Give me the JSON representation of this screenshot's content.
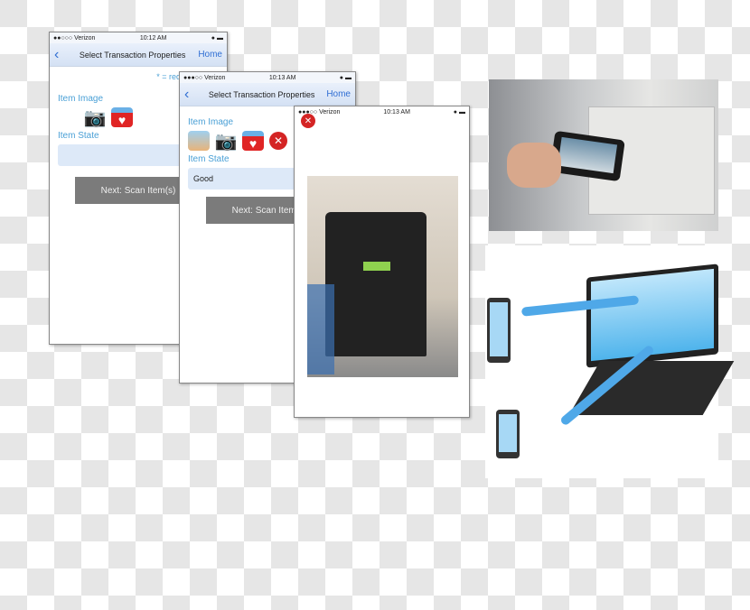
{
  "phone1": {
    "carrier": "●●○○○ Verizon",
    "time": "10:12 AM",
    "title": "Select Transaction Properties",
    "home": "Home",
    "required": "* = required field",
    "item_image": "Item Image",
    "item_state": "Item State",
    "state_value": "",
    "next": "Next: Scan Item(s)"
  },
  "phone2": {
    "carrier": "●●●○○ Verizon",
    "time": "10:13 AM",
    "title": "Select Transaction Properties",
    "home": "Home",
    "item_image": "Item Image",
    "item_state": "Item State",
    "state_value": "Good",
    "next": "Next: Scan Item(s)"
  },
  "phone3": {
    "carrier": "●●●○○ Verizon",
    "time": "10:13 AM"
  },
  "colors": {
    "accent": "#4aa0d6",
    "nav_link": "#2f6ed3",
    "button": "#7b7b7b",
    "delete": "#d42424"
  }
}
